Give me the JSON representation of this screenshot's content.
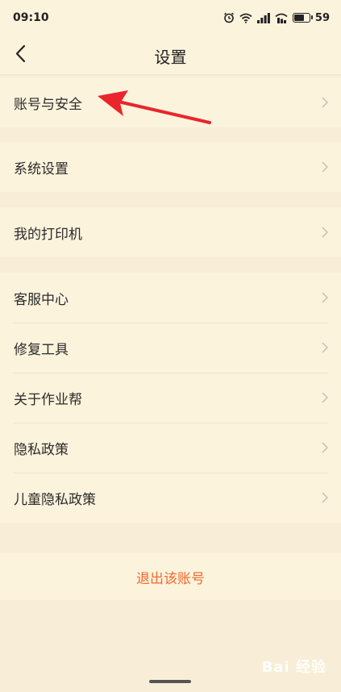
{
  "status_bar": {
    "time": "09:10",
    "battery": "59",
    "icons": [
      "alarm-icon",
      "wifi-icon",
      "signal-icon",
      "signal-icon-2",
      "battery-icon"
    ]
  },
  "nav": {
    "title": "设置",
    "back_icon": "chevron-left-icon"
  },
  "groups": [
    {
      "items": [
        {
          "label": "账号与安全"
        }
      ]
    },
    {
      "items": [
        {
          "label": "系统设置"
        }
      ]
    },
    {
      "items": [
        {
          "label": "我的打印机"
        }
      ]
    },
    {
      "items": [
        {
          "label": "客服中心"
        },
        {
          "label": "修复工具"
        },
        {
          "label": "关于作业帮"
        },
        {
          "label": "隐私政策"
        },
        {
          "label": "儿童隐私政策"
        }
      ]
    }
  ],
  "logout": {
    "label": "退出该账号"
  },
  "watermark": {
    "text": "Bai 经验"
  },
  "colors": {
    "background": "#f8eed7",
    "surface": "#fcf3dd",
    "accent": "#f2692e",
    "arrow": "#e8262c"
  }
}
